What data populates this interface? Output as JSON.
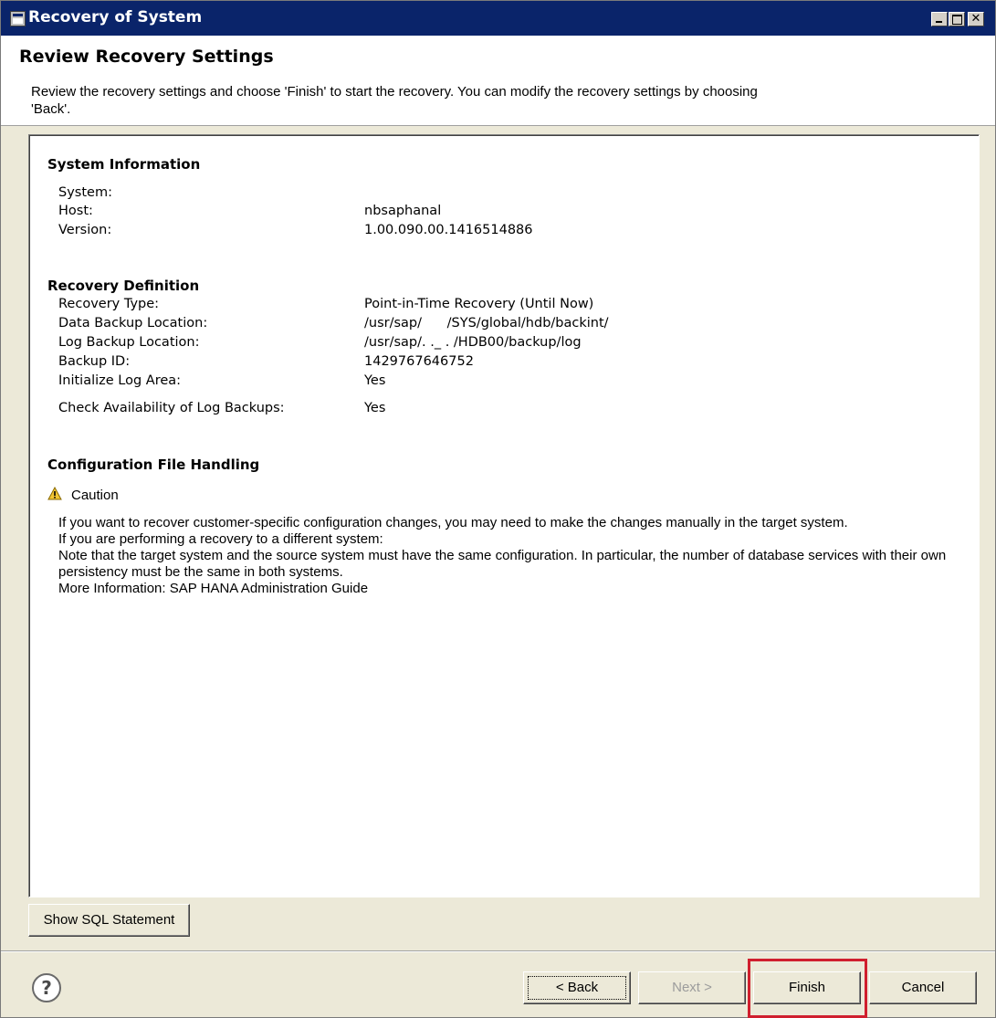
{
  "window": {
    "title": "Recovery of System"
  },
  "header": {
    "title": "Review Recovery Settings",
    "description": "Review the recovery settings and choose 'Finish' to start the recovery. You can modify the recovery settings by choosing 'Back'."
  },
  "system_info": {
    "heading": "System Information",
    "rows": [
      {
        "label": "System:",
        "value": ""
      },
      {
        "label": "Host:",
        "value": "nbsaphanal"
      },
      {
        "label": "Version:",
        "value": "1.00.090.00.1416514886"
      }
    ]
  },
  "recovery_def": {
    "heading": "Recovery Definition",
    "rows": [
      {
        "label": "Recovery Type:",
        "value": "Point-in-Time Recovery (Until Now)"
      },
      {
        "label": "Data Backup Location:",
        "value": "/usr/sap/      /SYS/global/hdb/backint/"
      },
      {
        "label": "Log Backup Location:",
        "value": "/usr/sap/. ._ . /HDB00/backup/log"
      },
      {
        "label": "Backup ID:",
        "value": "1429767646752"
      },
      {
        "label": "Initialize Log Area:",
        "value": "Yes"
      },
      {
        "label": "Check Availability of Log Backups:",
        "value": "Yes"
      }
    ]
  },
  "config": {
    "heading": "Configuration File Handling",
    "caution_icon": "warning-icon",
    "caution_label": "Caution",
    "lines": [
      "If you want to recover customer-specific configuration changes, you may need to make the changes manually in the target system.",
      "If you are performing a recovery to a different system:",
      "Note that the target system and the source system must have the same configuration. In particular, the number of database services with their own persistency must be the same in both systems.",
      "More Information: SAP HANA Administration Guide"
    ]
  },
  "buttons": {
    "show_sql": "Show SQL Statement",
    "help_icon": "help-icon",
    "back": "< Back",
    "next": "Next >",
    "finish": "Finish",
    "cancel": "Cancel"
  },
  "colors": {
    "titlebar": "#0a246a",
    "highlight": "#d01f2e",
    "disabled_text": "#9c9c9c"
  }
}
